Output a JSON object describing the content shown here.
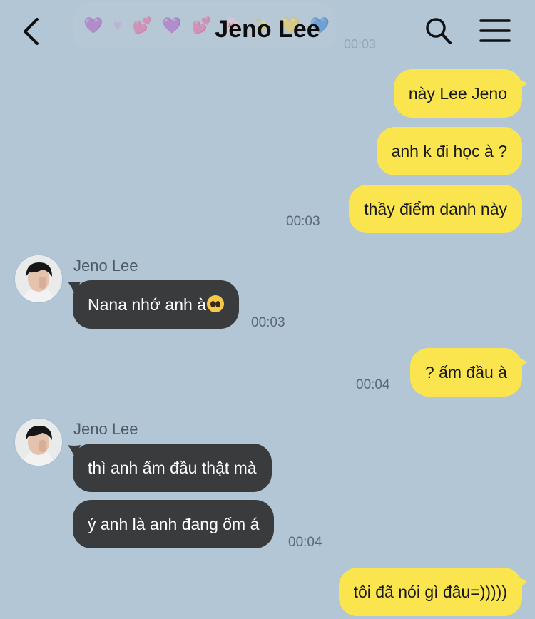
{
  "header": {
    "title": "Jeno Lee",
    "back_icon": "chevron-left-icon",
    "search_icon": "search-icon",
    "menu_icon": "menu-icon",
    "pinned_time": "00:03",
    "pinned_hearts": "💜 ♥ 💕 💜 💕 🌸 ✨ 💛 💙"
  },
  "messages": [
    {
      "side": "mine",
      "text": "này Lee Jeno"
    },
    {
      "side": "mine",
      "text": "anh k đi học à ?"
    },
    {
      "side": "mine",
      "text": "thầy điểm danh này",
      "time": "00:03"
    },
    {
      "side": "theirs",
      "sender": "Jeno Lee",
      "text": "Nana nhớ anh à",
      "emoji": "pleading-face",
      "time": "00:03"
    },
    {
      "side": "mine",
      "text": "? ấm đầu à",
      "time": "00:04"
    },
    {
      "side": "theirs",
      "sender": "Jeno Lee",
      "text": "thì anh ấm đầu thật mà"
    },
    {
      "side": "theirs",
      "text": "ý anh là anh đang ốm á",
      "time": "00:04"
    },
    {
      "side": "mine",
      "text": "tôi đã nói gì đâu=)))))"
    }
  ],
  "colors": {
    "background": "#b2c6d6",
    "my_bubble": "#fbe54e",
    "their_bubble": "#3a3b3d",
    "timestamp": "#5a6876"
  }
}
